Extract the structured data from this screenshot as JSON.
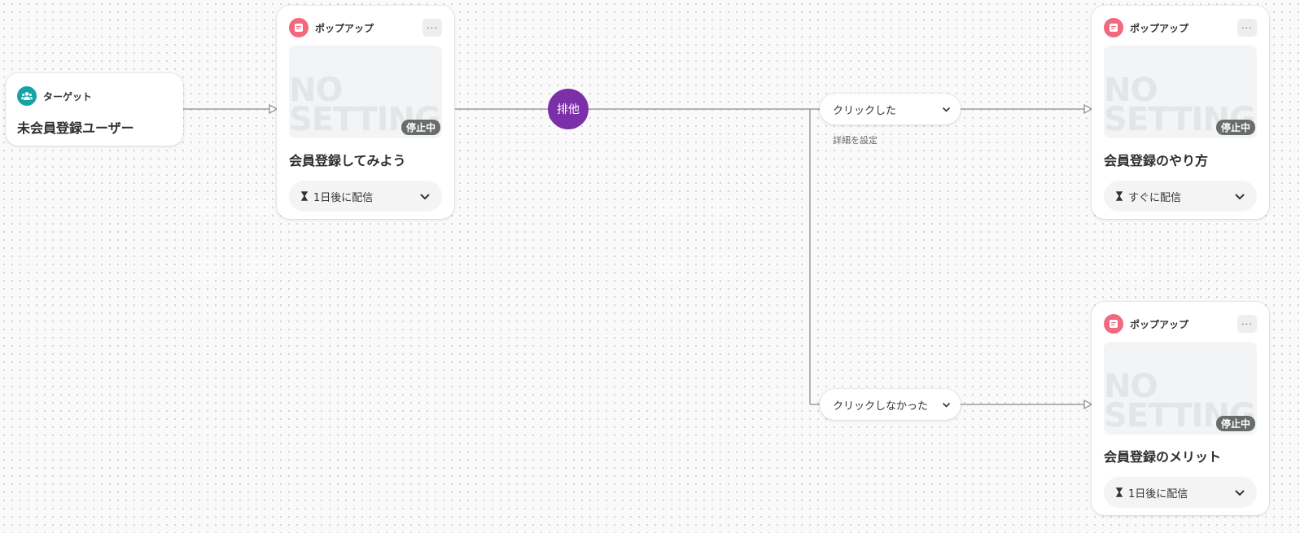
{
  "target": {
    "header_label": "ターゲット",
    "title": "未会員登録ユーザー",
    "icon": "users-icon"
  },
  "popups": [
    {
      "header_label": "ポップアップ",
      "more_label": "···",
      "preview_watermark": "NO SETTING",
      "status": "停止中",
      "title": "会員登録してみよう",
      "delivery": "1日後に配信"
    },
    {
      "header_label": "ポップアップ",
      "more_label": "···",
      "preview_watermark": "NO SETTING",
      "status": "停止中",
      "title": "会員登録のやり方",
      "delivery": "すぐに配信"
    },
    {
      "header_label": "ポップアップ",
      "more_label": "···",
      "preview_watermark": "NO SETTING",
      "status": "停止中",
      "title": "会員登録のメリット",
      "delivery": "1日後に配信"
    }
  ],
  "exclusive_node": {
    "label": "排他"
  },
  "branches": {
    "clicked": {
      "label": "クリックした",
      "detail_link": "詳細を設定"
    },
    "not_clicked": {
      "label": "クリックしなかった"
    }
  },
  "colors": {
    "target_icon": "#16a3a6",
    "popup_icon": "#f2687c",
    "exclusive": "#7b2fa8",
    "status_badge": "#686d6c",
    "connector": "#999999"
  }
}
